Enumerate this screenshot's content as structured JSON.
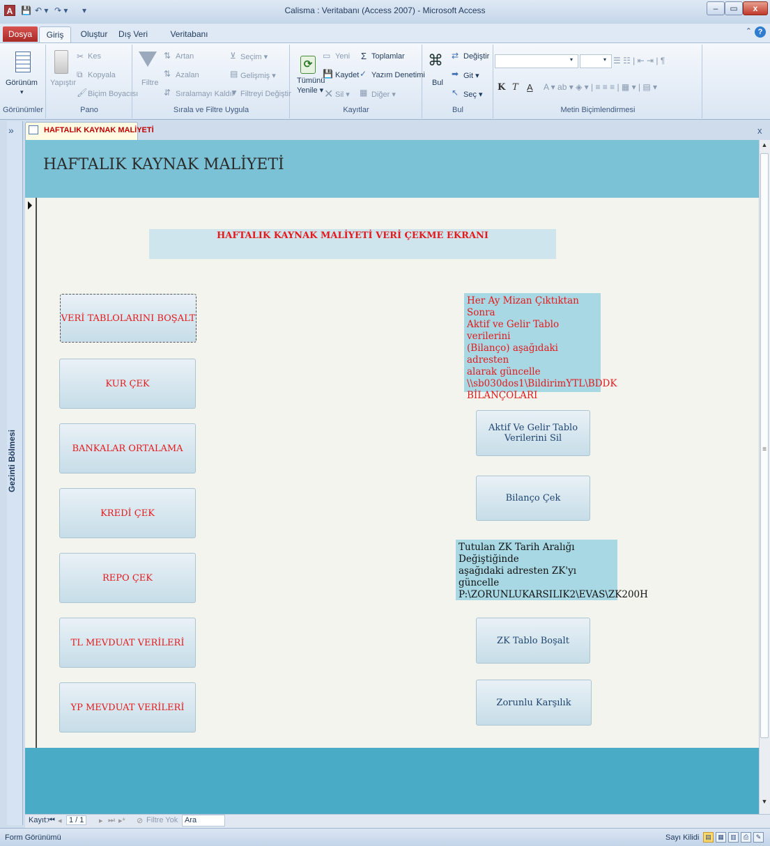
{
  "window": {
    "title": "Calisma : Veritabanı (Access 2007)  -  Microsoft Access",
    "app_icon": "A",
    "qat": {
      "save": "💾",
      "undo": "↶ ▾",
      "redo": "↷ ▾",
      "custom": "▾"
    },
    "minimize": "–",
    "restore": "▭",
    "close": "x"
  },
  "ribbon": {
    "tabs": [
      "Dosya",
      "Giriş",
      "Oluştur",
      "Dış Veri",
      "Veritabanı Araçları"
    ],
    "help": "?",
    "groups": {
      "gorunumler": {
        "label": "Görünümler",
        "view": "Görünüm",
        "arrow": "▾"
      },
      "pano": {
        "label": "Pano",
        "paste": "Yapıştır",
        "cut": "Kes",
        "copy": "Kopyala",
        "format_painter": "Biçim Boyacısı"
      },
      "sirala": {
        "label": "Sırala ve Filtre Uygula",
        "filter": "Filtre",
        "asc": "Artan",
        "desc": "Azalan",
        "remove_sort": "Sıralamayı Kaldır",
        "selection": "Seçim ▾",
        "advanced": "Gelişmiş ▾",
        "toggle_filter": "Filtreyi Değiştir"
      },
      "kayitlar": {
        "label": "Kayıtlar",
        "refresh": "Tümünü",
        "refresh2": "Yenile ▾",
        "new": "Yeni",
        "save": "Kaydet",
        "delete": "Sil ▾",
        "totals": "Toplamlar",
        "spelling": "Yazım Denetimi",
        "more": "Diğer ▾"
      },
      "bul": {
        "label": "Bul",
        "find": "Bul",
        "replace": "Değiştir",
        "goto": "Git ▾",
        "select": "Seç ▾"
      },
      "metin": {
        "label": "Metin Biçimlendirmesi",
        "bold": "K",
        "italic": "T",
        "underline": "A"
      }
    }
  },
  "nav_pane": {
    "label": "Gezinti Bölmesi",
    "toggle": "»"
  },
  "document_tab": {
    "label": "HAFTALIK KAYNAK MALİYETİ",
    "close": "x"
  },
  "form": {
    "title": "HAFTALIK KAYNAK MALİYETİ",
    "subtitle": "HAFTALIK KAYNAK MALİYETİ VERİ ÇEKME EKRANI",
    "left_buttons": [
      "VERİ TABLOLARINI BOŞALT",
      "KUR ÇEK",
      "BANKALAR ORTALAMA",
      "KREDİ ÇEK",
      "REPO ÇEK",
      "TL MEVDUAT VERİLERİ",
      "YP MEVDUAT VERİLERİ"
    ],
    "note1": "Her Ay Mizan Çıktıktan Sonra\nAktif ve Gelir Tablo verilerini\n(Bilanço) aşağıdaki adresten\nalarak  güncelle\n\\\\sb030dos1\\BildirimYTL\\BDDK\n BİLANÇOLARI",
    "btn_aktif": "Aktif Ve Gelir Tablo Verilerini Sil",
    "btn_bilanco": "Bilanço Çek",
    "note2": "Tutulan ZK Tarih Aralığı Değiştiğinde\naşağıdaki adresten ZK'yı güncelle\nP:\\ZORUNLUKARSILIK2\\EVAS\\ZK200H",
    "btn_zk": "ZK Tablo Boşalt",
    "btn_zorunlu": "Zorunlu Karşılık",
    "colors": {
      "header": "#7cc2d6",
      "footer": "#4aabc6",
      "red_text": "#e4191b",
      "note_bg": "#a7d8e4"
    }
  },
  "record_nav": {
    "label": "Kayıt:",
    "first": "⏮",
    "prev": "◂",
    "position": "1 / 1",
    "next": "▸",
    "last": "⏭",
    "new": "▸*",
    "filter": "Filtre Yok",
    "search": "Ara"
  },
  "status": {
    "left": "Form Görünümü",
    "right": "Sayı Kilidi"
  }
}
